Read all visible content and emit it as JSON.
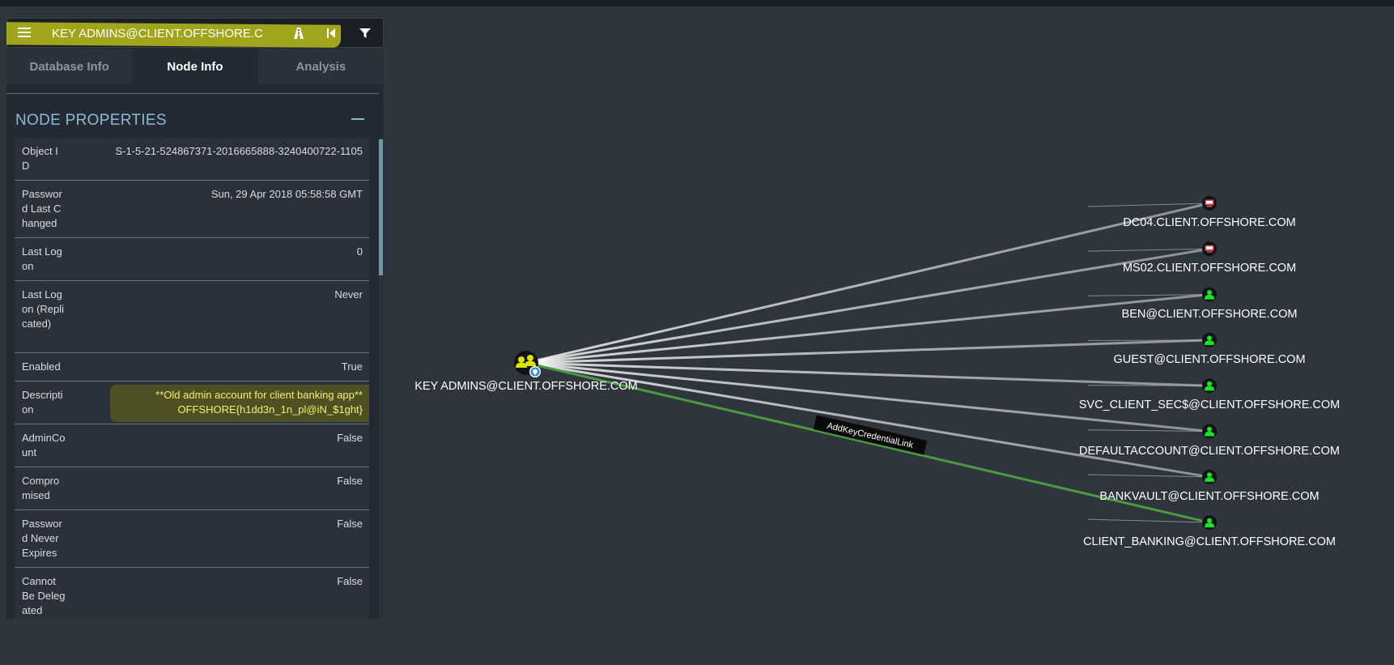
{
  "search": {
    "value": "KEY ADMINS@CLIENT.OFFSHORE.C"
  },
  "tabs": [
    {
      "label": "Database Info"
    },
    {
      "label": "Node Info"
    },
    {
      "label": "Analysis"
    }
  ],
  "section": {
    "title": "NODE PROPERTIES"
  },
  "properties": [
    {
      "key": "Object ID",
      "value": "S-1-5-21-524867371-2016665888-3240400722-1105"
    },
    {
      "key": "Password Last Changed",
      "value": "Sun, 29 Apr 2018 05:58:58 GMT"
    },
    {
      "key": "Last Logon",
      "value": "0"
    },
    {
      "key": "Last Logon (Replicated)",
      "value": "Never"
    },
    {
      "key": "Enabled",
      "value": "True"
    },
    {
      "key": "Description",
      "value": "**Old admin account for client banking app**",
      "value2": "OFFSHORE{h1dd3n_1n_pl@iN_$1ght}"
    },
    {
      "key": "AdminCount",
      "value": "False"
    },
    {
      "key": "Compromised",
      "value": "False"
    },
    {
      "key": "Password Never Expires",
      "value": "False"
    },
    {
      "key": "Cannot Be Delegated",
      "value": "False"
    }
  ],
  "graph": {
    "source": {
      "label": "KEY ADMINS@CLIENT.OFFSHORE.COM",
      "icon": "group-icon"
    },
    "targets": [
      {
        "label": "DC04.CLIENT.OFFSHORE.COM",
        "icon": "computer-icon"
      },
      {
        "label": "MS02.CLIENT.OFFSHORE.COM",
        "icon": "computer-icon"
      },
      {
        "label": "BEN@CLIENT.OFFSHORE.COM",
        "icon": "user-icon"
      },
      {
        "label": "GUEST@CLIENT.OFFSHORE.COM",
        "icon": "user-icon"
      },
      {
        "label": "SVC_CLIENT_SEC$@CLIENT.OFFSHORE.COM",
        "icon": "user-icon"
      },
      {
        "label": "DEFAULTACCOUNT@CLIENT.OFFSHORE.COM",
        "icon": "user-icon"
      },
      {
        "label": "BANKVAULT@CLIENT.OFFSHORE.COM",
        "icon": "user-icon"
      },
      {
        "label": "CLIENT_BANKING@CLIENT.OFFSHORE.COM",
        "icon": "user-icon"
      }
    ],
    "edge_label": "AddKeyCredentialLink",
    "colors": {
      "computer": "#e0454f",
      "user": "#17e625",
      "group": "#dbe300",
      "highlight_edge": "#4a9a3f"
    }
  }
}
